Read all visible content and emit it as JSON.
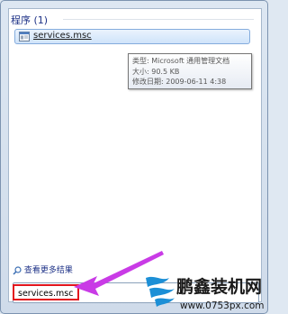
{
  "start_menu": {
    "group_header": "程序 (1)",
    "result": {
      "label": "services.msc",
      "icon": "msc-file-icon"
    },
    "tooltip": {
      "type_line": "类型: Microsoft 通用管理文档",
      "size_line": "大小: 90.5 KB",
      "modified_line": "修改日期: 2009-06-11 4:38"
    },
    "see_more": "查看更多结果",
    "search_value": "services.msc"
  },
  "annotation": {
    "highlight_color": "#e3161e",
    "arrow_color": "#c93be6"
  },
  "watermark": {
    "title": "鹏鑫装机网",
    "url": "www.0753px.com"
  }
}
